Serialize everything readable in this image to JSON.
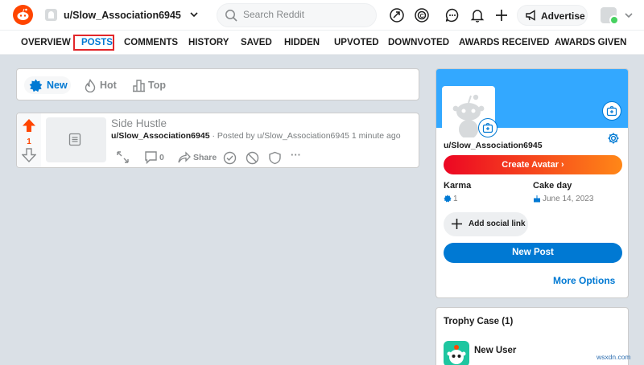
{
  "header": {
    "username": "u/Slow_Association6945",
    "search_placeholder": "Search Reddit",
    "advertise_label": "Advertise"
  },
  "tabs": [
    {
      "label": "OVERVIEW"
    },
    {
      "label": "POSTS"
    },
    {
      "label": "COMMENTS"
    },
    {
      "label": "HISTORY"
    },
    {
      "label": "SAVED"
    },
    {
      "label": "HIDDEN"
    },
    {
      "label": "UPVOTED"
    },
    {
      "label": "DOWNVOTED"
    },
    {
      "label": "AWARDS RECEIVED"
    },
    {
      "label": "AWARDS GIVEN"
    }
  ],
  "active_tab": "POSTS",
  "sort": {
    "new_label": "New",
    "hot_label": "Hot",
    "top_label": "Top",
    "active": "New"
  },
  "post": {
    "score": "1",
    "title": "Side Hustle",
    "subreddit": "u/Slow_Association6945",
    "meta": "· Posted by u/Slow_Association6945 1 minute ago",
    "comments_count": "0",
    "share_label": "Share",
    "more_label": "···"
  },
  "profile": {
    "username": "u/Slow_Association6945",
    "create_avatar_label": "Create Avatar ›",
    "karma_label": "Karma",
    "karma_value": "1",
    "cake_day_label": "Cake day",
    "cake_day_value": "June 14, 2023",
    "social_link_label": "Add social link",
    "new_post_label": "New Post",
    "more_options_label": "More Options"
  },
  "trophy": {
    "title": "Trophy Case (1)",
    "item_name": "New User"
  },
  "watermark": "wsxdn.com",
  "colors": {
    "brand": "#ff4500",
    "link_blue": "#0079d3",
    "banner_blue": "#33a8ff",
    "highlight_box": "#e2262a"
  },
  "icons": [
    "reddit-logo-icon",
    "search-icon",
    "popular-icon",
    "coins-icon",
    "chat-icon",
    "bell-icon",
    "plus-icon",
    "megaphone-icon"
  ]
}
